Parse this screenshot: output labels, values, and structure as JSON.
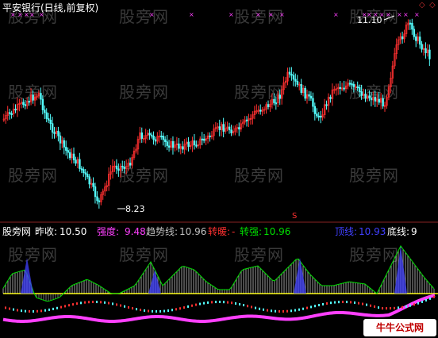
{
  "title": "平安银行(日线,前复权)",
  "price_panel": {
    "high_label": "11.10",
    "low_label": "8.23",
    "signal_mark": "S"
  },
  "indicator_bar": {
    "prefix": "股旁网",
    "prev_close_label": "昨收:",
    "prev_close_value": "10.50",
    "strength_label": "强度:",
    "strength_value": "9.48",
    "trend_label": "趋势线:",
    "trend_value": "10.96",
    "warm_label": "转暖:",
    "warm_value": "-",
    "strong_label": "转强:",
    "strong_value": "10.96",
    "top_label": "顶线:",
    "top_value": "10.93",
    "bottom_label": "底线:",
    "bottom_value": "9"
  },
  "watermark": "股旁网",
  "stamp": "牛牛公式网",
  "colors": {
    "bull": "#ff3030",
    "bear": "#54ffff",
    "strength": "#ff40ff",
    "trend": "#c0c0c0",
    "warm": "#ff3030",
    "strong": "#00e000",
    "top": "#4040ff",
    "bottom": "#ffffff",
    "baseline": "#ffff00"
  }
}
